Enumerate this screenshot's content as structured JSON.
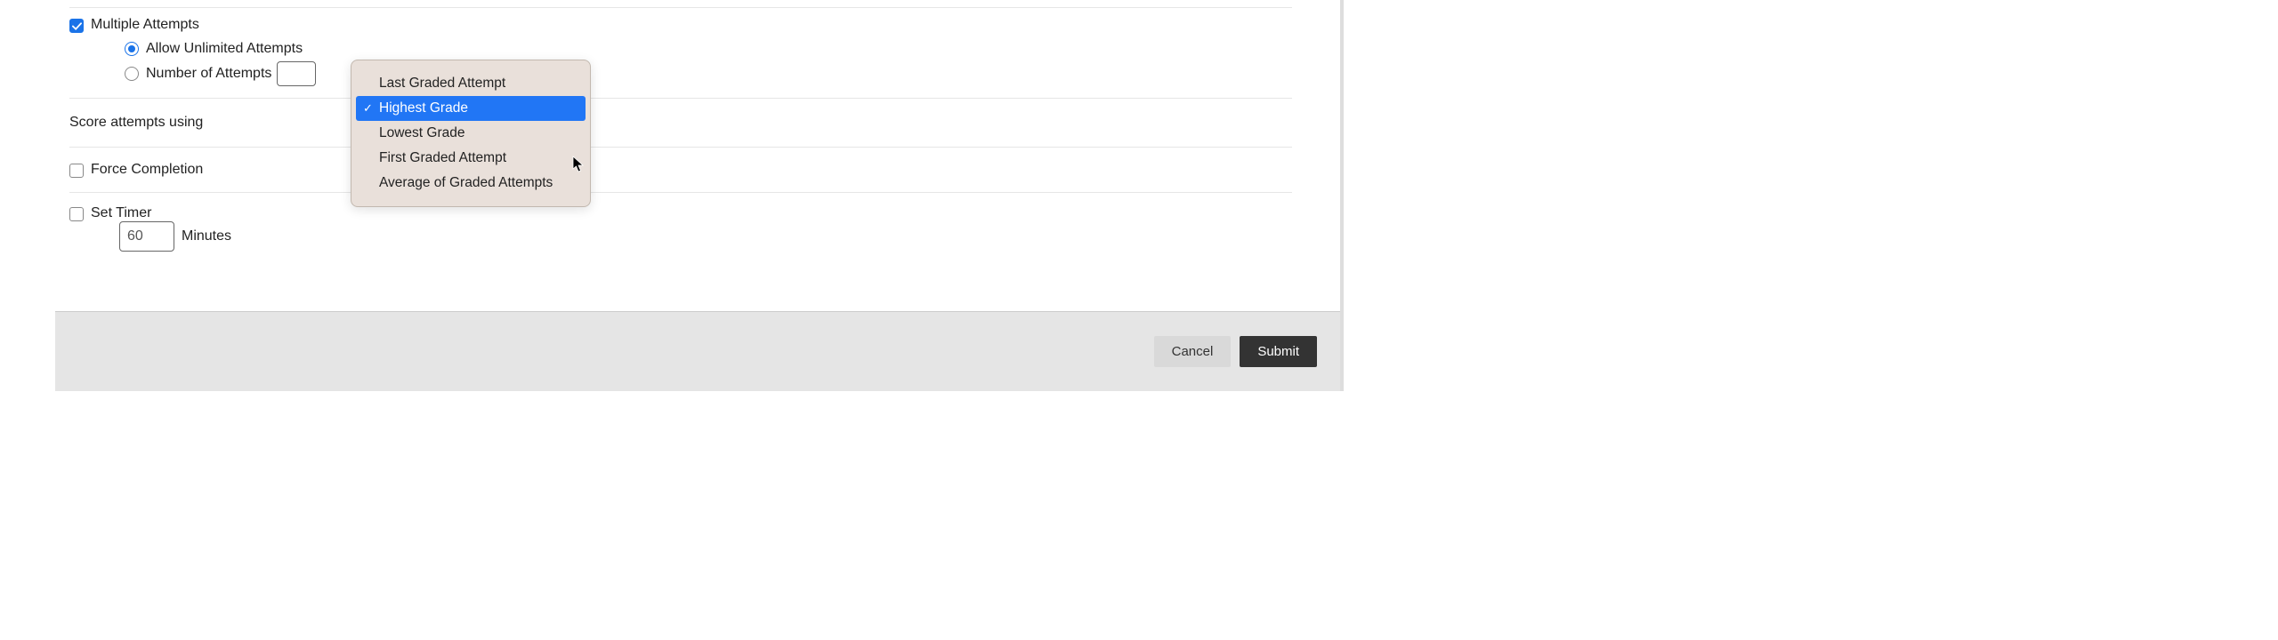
{
  "multiple_attempts": {
    "label": "Multiple Attempts",
    "checked": true,
    "allow_unlimited": {
      "label": "Allow Unlimited Attempts",
      "selected": true
    },
    "number_of": {
      "label": "Number of Attempts",
      "selected": false,
      "value": ""
    }
  },
  "score": {
    "label": "Score attempts using",
    "options": [
      "Last Graded Attempt",
      "Highest Grade",
      "Lowest Grade",
      "First Graded Attempt",
      "Average of Graded Attempts"
    ],
    "highlighted_index": 1
  },
  "force_completion": {
    "label": "Force Completion",
    "checked": false
  },
  "set_timer": {
    "label": "Set Timer",
    "checked": false,
    "value": "60",
    "unit": "Minutes"
  },
  "buttons": {
    "cancel": "Cancel",
    "submit": "Submit"
  }
}
